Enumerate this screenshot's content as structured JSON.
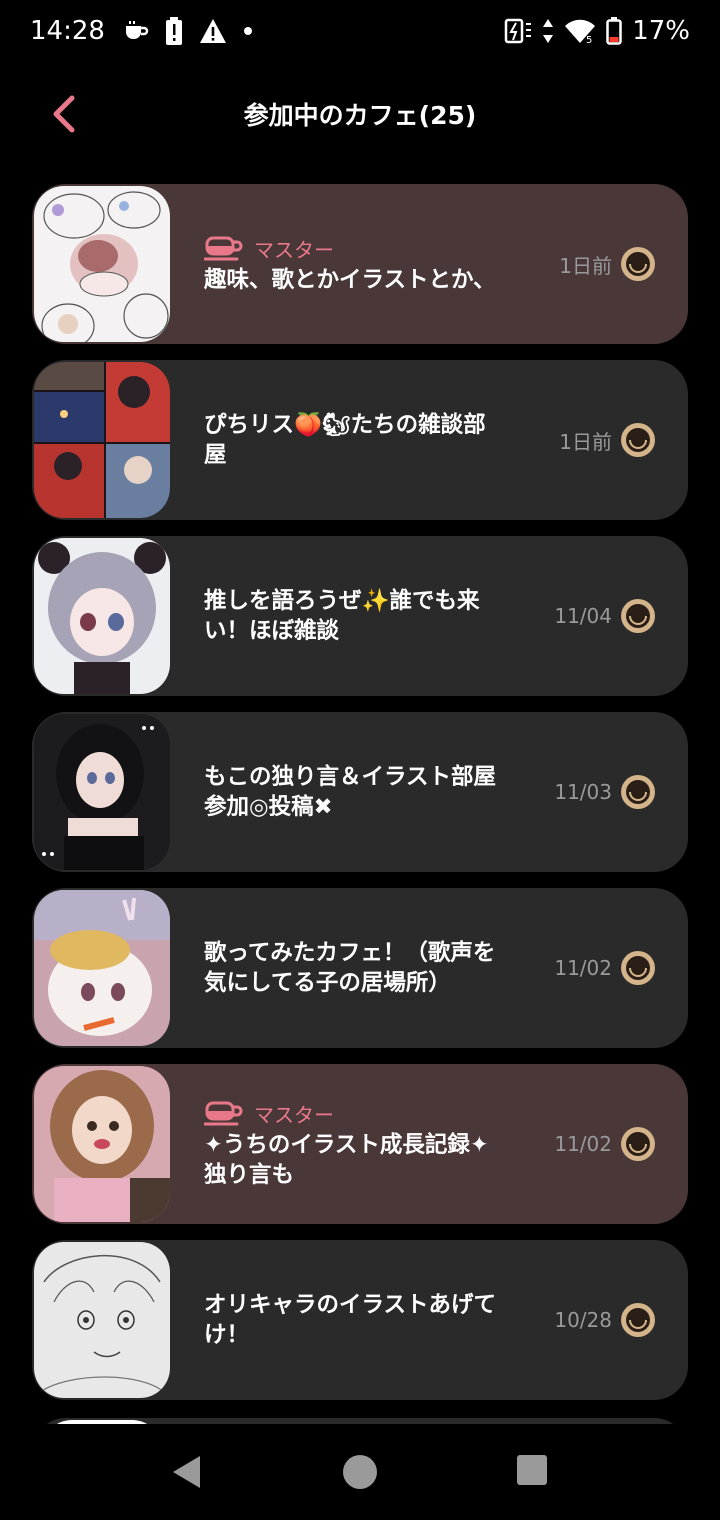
{
  "status_bar": {
    "time": "14:28",
    "battery_percent": "17%",
    "left_icons": [
      "cup-icon",
      "battery-alert-icon",
      "warning-icon",
      "dot-icon"
    ],
    "right_icons": [
      "battery-saver-icon",
      "data-arrows-icon",
      "wifi-icon",
      "battery-icon"
    ]
  },
  "header": {
    "title": "参加中のカフェ(25)"
  },
  "accent_color": "#e8788a",
  "cafes": [
    {
      "name": "趣味、歌とかイラストとか、",
      "date": "1日前",
      "badge": "マスター"
    },
    {
      "name": "ぴちリス🍑🐿たちの雑談部\n屋",
      "date": "1日前",
      "badge": ""
    },
    {
      "name": "推しを語ろうぜ✨誰でも来\nい！ほぼ雑談",
      "date": "11/04",
      "badge": ""
    },
    {
      "name": "もこの独り言＆イラスト部屋\n参加◎投稿✖",
      "date": "11/03",
      "badge": ""
    },
    {
      "name": "歌ってみたカフェ！（歌声を\n気にしてる子の居場所）",
      "date": "11/02",
      "badge": ""
    },
    {
      "name": "✦うちのイラスト成長記録✦\n独り言も",
      "date": "11/02",
      "badge": "マスター"
    },
    {
      "name": "オリキャラのイラストあげて\nけ！",
      "date": "10/28",
      "badge": ""
    }
  ]
}
